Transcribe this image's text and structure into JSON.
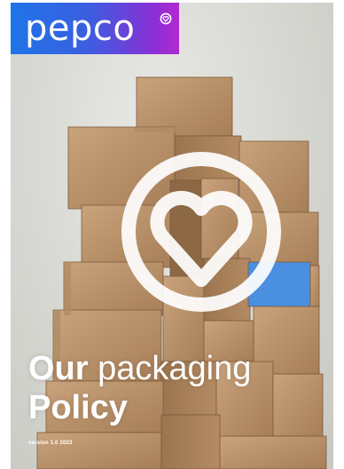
{
  "brand": {
    "name": "pepco",
    "logo_gradient": [
      "#1f74e8",
      "#b12ad0"
    ],
    "accent_box_color": "#4a8fe0"
  },
  "cover": {
    "title_word_1": "Our",
    "title_word_2": "packaging",
    "title_line_2": "Policy",
    "version": "version 1.0 2023",
    "emblem_icon": "heart-ring-icon"
  }
}
